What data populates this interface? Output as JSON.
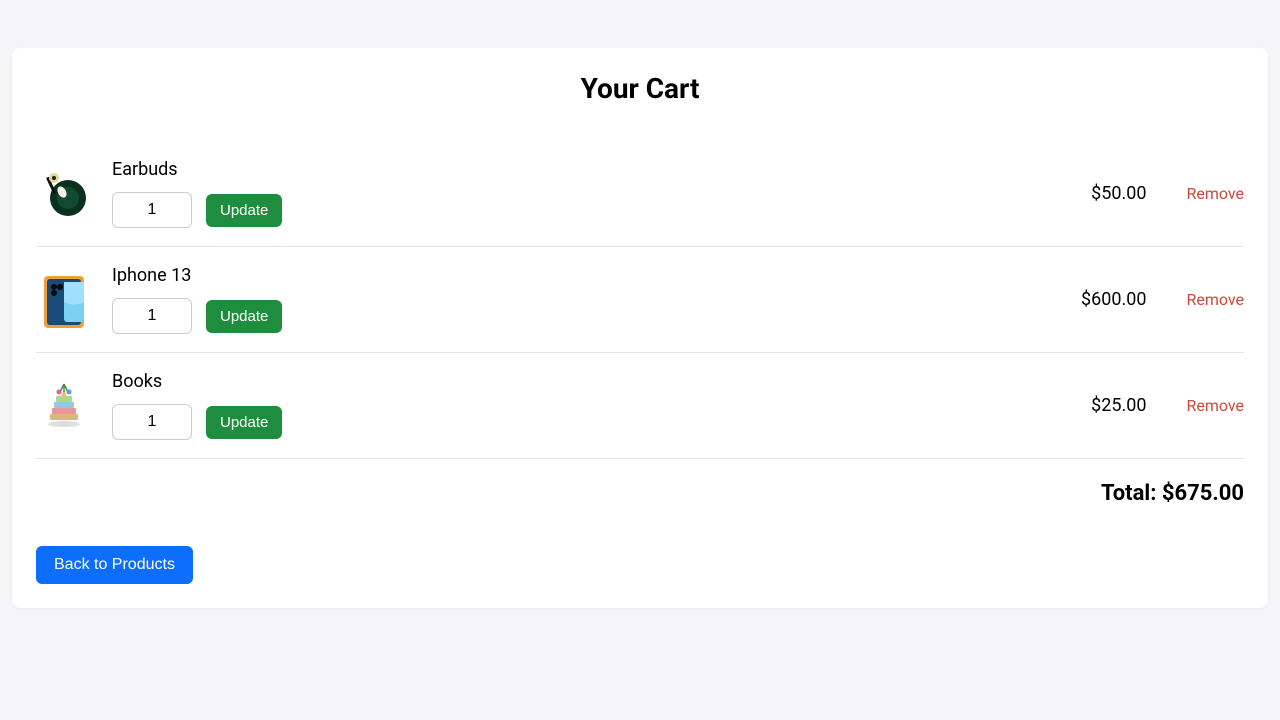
{
  "header": {
    "title": "Your Cart"
  },
  "items": [
    {
      "name": "Earbuds",
      "quantity": "1",
      "price": "$50.00",
      "update_label": "Update",
      "remove_label": "Remove",
      "icon": "earbuds-icon"
    },
    {
      "name": "Iphone 13",
      "quantity": "1",
      "price": "$600.00",
      "update_label": "Update",
      "remove_label": "Remove",
      "icon": "iphone-icon"
    },
    {
      "name": "Books",
      "quantity": "1",
      "price": "$25.00",
      "update_label": "Update",
      "remove_label": "Remove",
      "icon": "books-icon"
    }
  ],
  "total": {
    "label": "Total: $675.00"
  },
  "actions": {
    "back_label": "Back to Products"
  }
}
